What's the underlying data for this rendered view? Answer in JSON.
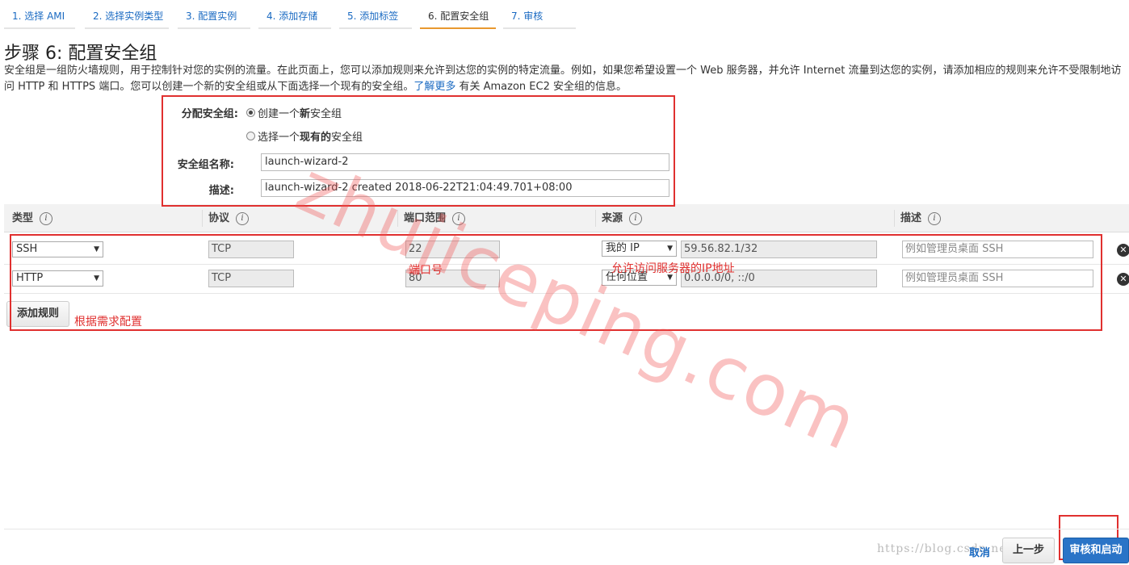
{
  "tabs": [
    {
      "label": "1. 选择 AMI"
    },
    {
      "label": "2. 选择实例类型"
    },
    {
      "label": "3. 配置实例"
    },
    {
      "label": "4. 添加存储"
    },
    {
      "label": "5. 添加标签"
    },
    {
      "label": "6. 配置安全组",
      "active": true
    },
    {
      "label": "7. 审核"
    }
  ],
  "page": {
    "title": "步骤 6: 配置安全组",
    "description": "安全组是一组防火墙规则，用于控制针对您的实例的流量。在此页面上，您可以添加规则来允许到达您的实例的特定流量。例如，如果您希望设置一个 Web 服务器，并允许 Internet 流量到达您的实例，请添加相应的规则来允许不受限制地访问 HTTP 和 HTTPS 端口。您可以创建一个新的安全组或从下面选择一个现有的安全组。",
    "learn_more": "了解更多",
    "description_tail": " 有关 Amazon EC2 安全组的信息。"
  },
  "assign": {
    "label": "分配安全组:",
    "option_new_pre": "创建一个",
    "option_new_bold": "新",
    "option_new_post": "安全组",
    "option_existing_pre": "选择一个",
    "option_existing_bold": "现有的",
    "option_existing_post": "安全组",
    "selected": "new",
    "name_label": "安全组名称:",
    "name_value": "launch-wizard-2",
    "desc_label": "描述:",
    "desc_value": "launch-wizard-2 created 2018-06-22T21:04:49.701+08:00"
  },
  "table": {
    "headers": {
      "type": "类型",
      "protocol": "协议",
      "port": "端口范围",
      "source": "来源",
      "description": "描述"
    },
    "info_glyph": "i",
    "rows": [
      {
        "type": "SSH",
        "protocol": "TCP",
        "port": "22",
        "source_type": "我的 IP",
        "source_value": "59.56.82.1/32",
        "desc_placeholder": "例如管理员桌面 SSH"
      },
      {
        "type": "HTTP",
        "protocol": "TCP",
        "port": "80",
        "source_type": "任何位置",
        "source_value": "0.0.0.0/0, ::/0",
        "desc_placeholder": "例如管理员桌面 SSH"
      }
    ],
    "remove_glyph": "✕",
    "add_rule": "添加规则"
  },
  "annotations": {
    "port_note": "端口号",
    "source_note": "允许访问服务器的IP地址",
    "config_note": "根据需求配置",
    "watermark": "zhujiceping.com"
  },
  "footer": {
    "url_text": "https://blog.csdn.net/",
    "cancel": "取消",
    "previous": "上一步",
    "review_launch": "审核和启动"
  },
  "colors": {
    "link": "#1a6ac2",
    "active_tab": "#e8982f",
    "annotation": "#e0302f",
    "primary_button": "#2a74c7"
  }
}
